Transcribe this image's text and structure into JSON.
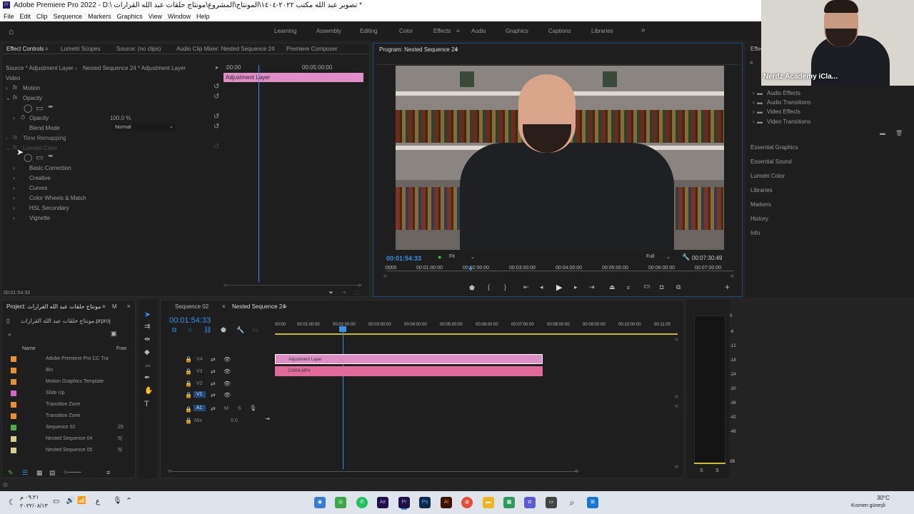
{
  "window": {
    "title": "Adobe Premiere Pro 2022 - D:\\ تصوير عبد الله مكتب ٢٠٢٢-١٤٠٤\\المونتاج\\المشروع\\مونتاج حلقات عبد الله القرارات *",
    "app_icon": "Pr"
  },
  "menu": [
    "File",
    "Edit",
    "Clip",
    "Sequence",
    "Markers",
    "Graphics",
    "View",
    "Window",
    "Help"
  ],
  "workspaces": {
    "items": [
      "Learning",
      "Assembly",
      "Editing",
      "Color",
      "Effects",
      "Audio",
      "Graphics",
      "Captions",
      "Libraries"
    ],
    "active": "Effects",
    "more": "»"
  },
  "effect_controls": {
    "tabs": [
      "Effect Controls",
      "Lumetri Scopes",
      "Source: (no clips)",
      "Audio Clip Mixer: Nested Sequence 24",
      "Premiere Composer"
    ],
    "source": "Source * Adjustment Layer",
    "sequence": "Nested Sequence 24 * Adjustment Layer",
    "time_start": ":00:00",
    "time_end": "00:05:00:00",
    "clip_label": "Adjustment Layer",
    "section": "Video",
    "motion": "Motion",
    "opacity": "Opacity",
    "opacity_param": "Opacity",
    "opacity_value": "100.0 %",
    "blend_mode": "Blend Mode",
    "blend_value": "Normal",
    "time_remap": "Time Remapping",
    "lumetri": "Lumetri Color",
    "lumetri_items": [
      "Basic Correction",
      "Creative",
      "Curves",
      "Color Wheels & Match",
      "HSL Secondary",
      "Vignette"
    ],
    "timecode": "00:01:54:33"
  },
  "program": {
    "title": "Program: Nested Sequence 24",
    "timecode": "00:01:54:33",
    "fit": "Fit",
    "quality": "Full",
    "duration": "00:07:30:49",
    "ruler": [
      ":0000",
      "00:01:00:00",
      "00:02:00:00",
      "00:03:00:00",
      "00:04:00:00",
      "00:05:00:00",
      "00:06:00:00",
      "00:07:00:00"
    ]
  },
  "effects_panel": {
    "tab": "Effec",
    "folders": [
      "Audio Effects",
      "Audio Transitions",
      "Video Effects",
      "Video Transitions"
    ],
    "panels": [
      "Essential Graphics",
      "Essential Sound",
      "Lumetri Color",
      "Libraries",
      "Markers",
      "History",
      "Info"
    ]
  },
  "webcam": {
    "name": "Nerdz Academy iCla..."
  },
  "project": {
    "tab": "Project: مونتاج حلقات عبد الله القرارات",
    "tab2": "M",
    "file": "مونتاج حلقات عبد الله القرارات.prproj",
    "col_name": "Name",
    "col_fr": "Fran",
    "items": [
      {
        "name": "Adobe Premiere Pro CC Tra",
        "color": "#e8902a",
        "fr": ""
      },
      {
        "name": "Bin",
        "color": "#e8902a",
        "fr": ""
      },
      {
        "name": "Motion Graphics Template",
        "color": "#e8902a",
        "fr": ""
      },
      {
        "name": "Slide Up",
        "color": "#d765c9",
        "fr": ""
      },
      {
        "name": "Transition Zone",
        "color": "#e8902a",
        "fr": ""
      },
      {
        "name": "Transition Zone",
        "color": "#e8902a",
        "fr": ""
      },
      {
        "name": "Sequence 02",
        "color": "#4ab24a",
        "fr": "25"
      },
      {
        "name": "Nested Sequence 04",
        "color": "#d9d08a",
        "fr": "5("
      },
      {
        "name": "Nested Sequence 05",
        "color": "#d9d08a",
        "fr": "5("
      }
    ]
  },
  "timeline": {
    "tabs": [
      "Sequence 02",
      "Nested Sequence 24"
    ],
    "timecode": "00:01:54:33",
    "ruler": [
      "00:00",
      "00:01:00:00",
      "00:02:00:00",
      "00:03:00:00",
      "00:04:00:00",
      "00:05:00:00",
      "00:06:00:00",
      "00:07:00:00",
      "00:08:00:00",
      "00:09:00:00",
      "00:10:00:00",
      "00:11:00"
    ],
    "tracks": [
      "V4",
      "V3",
      "V2",
      "V1",
      "A1"
    ],
    "mix": "Mix",
    "mix_value": "0.0",
    "m": "M",
    "s": "S",
    "clip_adj": "Adjustment Layer",
    "clip_vid": "C0006.MP4"
  },
  "meters": {
    "labels": [
      "0",
      "-6",
      "-12",
      "-18",
      "-24",
      "-30",
      "-36",
      "-42",
      "-48",
      "dB"
    ],
    "s": "S"
  },
  "taskbar": {
    "left_time": "٠٩:٢١ م",
    "left_date": "٢٠٢٢/٠٨/١٣",
    "lang": "ع",
    "weather_temp": "30°C",
    "weather_text": "Kısmen güneşli",
    "apps": [
      {
        "label": "",
        "color": "#3a7bd5"
      },
      {
        "label": "",
        "color": "#39a845"
      },
      {
        "label": "",
        "color": "#22c15e"
      },
      {
        "label": "Ae",
        "color": "#1f1146"
      },
      {
        "label": "Pr",
        "color": "#1f1146"
      },
      {
        "label": "Ps",
        "color": "#0a2b4d"
      },
      {
        "label": "Ai",
        "color": "#3a1400"
      },
      {
        "label": "",
        "color": "#e84c3d"
      },
      {
        "label": "",
        "color": "#f0b322"
      },
      {
        "label": "",
        "color": "#2e9c58"
      },
      {
        "label": "",
        "color": "#5b5bd6"
      },
      {
        "label": "",
        "color": "#444"
      },
      {
        "label": "",
        "color": "#1677d1"
      }
    ]
  }
}
